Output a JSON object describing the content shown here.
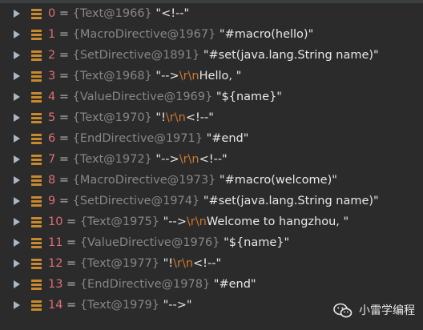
{
  "colors": {
    "background": "#2b2b2b",
    "index": "#e06c75",
    "type": "#878787",
    "string": "#e8e8e8",
    "escape": "#cc7832",
    "field_icon": "#c9892e"
  },
  "icons": {
    "expand": "triangle-right",
    "field": "field-icon"
  },
  "variables": [
    {
      "index": "0",
      "eq": " = ",
      "type": "{Text@1966}",
      "value": [
        {
          "t": "\"<!--\"",
          "k": "str"
        }
      ]
    },
    {
      "index": "1",
      "eq": " = ",
      "type": "{MacroDirective@1967}",
      "value": [
        {
          "t": "\"#macro(hello)\"",
          "k": "str"
        }
      ]
    },
    {
      "index": "2",
      "eq": " = ",
      "type": "{SetDirective@1891}",
      "value": [
        {
          "t": "\"#set(java.lang.String name)\"",
          "k": "str"
        }
      ]
    },
    {
      "index": "3",
      "eq": " = ",
      "type": "{Text@1968}",
      "value": [
        {
          "t": "\"-->",
          "k": "str"
        },
        {
          "t": "\\r\\n",
          "k": "esc"
        },
        {
          "t": "Hello, \"",
          "k": "str"
        }
      ]
    },
    {
      "index": "4",
      "eq": " = ",
      "type": "{ValueDirective@1969}",
      "value": [
        {
          "t": "\"${name}\"",
          "k": "str"
        }
      ]
    },
    {
      "index": "5",
      "eq": " = ",
      "type": "{Text@1970}",
      "value": [
        {
          "t": "\"!",
          "k": "str"
        },
        {
          "t": "\\r\\n",
          "k": "esc"
        },
        {
          "t": "<!--\"",
          "k": "str"
        }
      ]
    },
    {
      "index": "6",
      "eq": " = ",
      "type": "{EndDirective@1971}",
      "value": [
        {
          "t": "\"#end\"",
          "k": "str"
        }
      ]
    },
    {
      "index": "7",
      "eq": " = ",
      "type": "{Text@1972}",
      "value": [
        {
          "t": "\"-->",
          "k": "str"
        },
        {
          "t": "\\r\\n",
          "k": "esc"
        },
        {
          "t": "<!--\"",
          "k": "str"
        }
      ]
    },
    {
      "index": "8",
      "eq": " = ",
      "type": "{MacroDirective@1973}",
      "value": [
        {
          "t": "\"#macro(welcome)\"",
          "k": "str"
        }
      ]
    },
    {
      "index": "9",
      "eq": " = ",
      "type": "{SetDirective@1974}",
      "value": [
        {
          "t": "\"#set(java.lang.String name)\"",
          "k": "str"
        }
      ]
    },
    {
      "index": "10",
      "eq": " = ",
      "type": "{Text@1975}",
      "value": [
        {
          "t": "\"-->",
          "k": "str"
        },
        {
          "t": "\\r\\n",
          "k": "esc"
        },
        {
          "t": "Welcome to hangzhou, \"",
          "k": "str"
        }
      ]
    },
    {
      "index": "11",
      "eq": " = ",
      "type": "{ValueDirective@1976}",
      "value": [
        {
          "t": "\"${name}\"",
          "k": "str"
        }
      ]
    },
    {
      "index": "12",
      "eq": " = ",
      "type": "{Text@1977}",
      "value": [
        {
          "t": "\"!",
          "k": "str"
        },
        {
          "t": "\\r\\n",
          "k": "esc"
        },
        {
          "t": "<!--\"",
          "k": "str"
        }
      ]
    },
    {
      "index": "13",
      "eq": " = ",
      "type": "{EndDirective@1978}",
      "value": [
        {
          "t": "\"#end\"",
          "k": "str"
        }
      ]
    },
    {
      "index": "14",
      "eq": " = ",
      "type": "{Text@1979}",
      "value": [
        {
          "t": "\"-->\"",
          "k": "str"
        }
      ]
    }
  ],
  "watermark": {
    "icon": "wechat-icon",
    "text": "小雷学编程"
  }
}
